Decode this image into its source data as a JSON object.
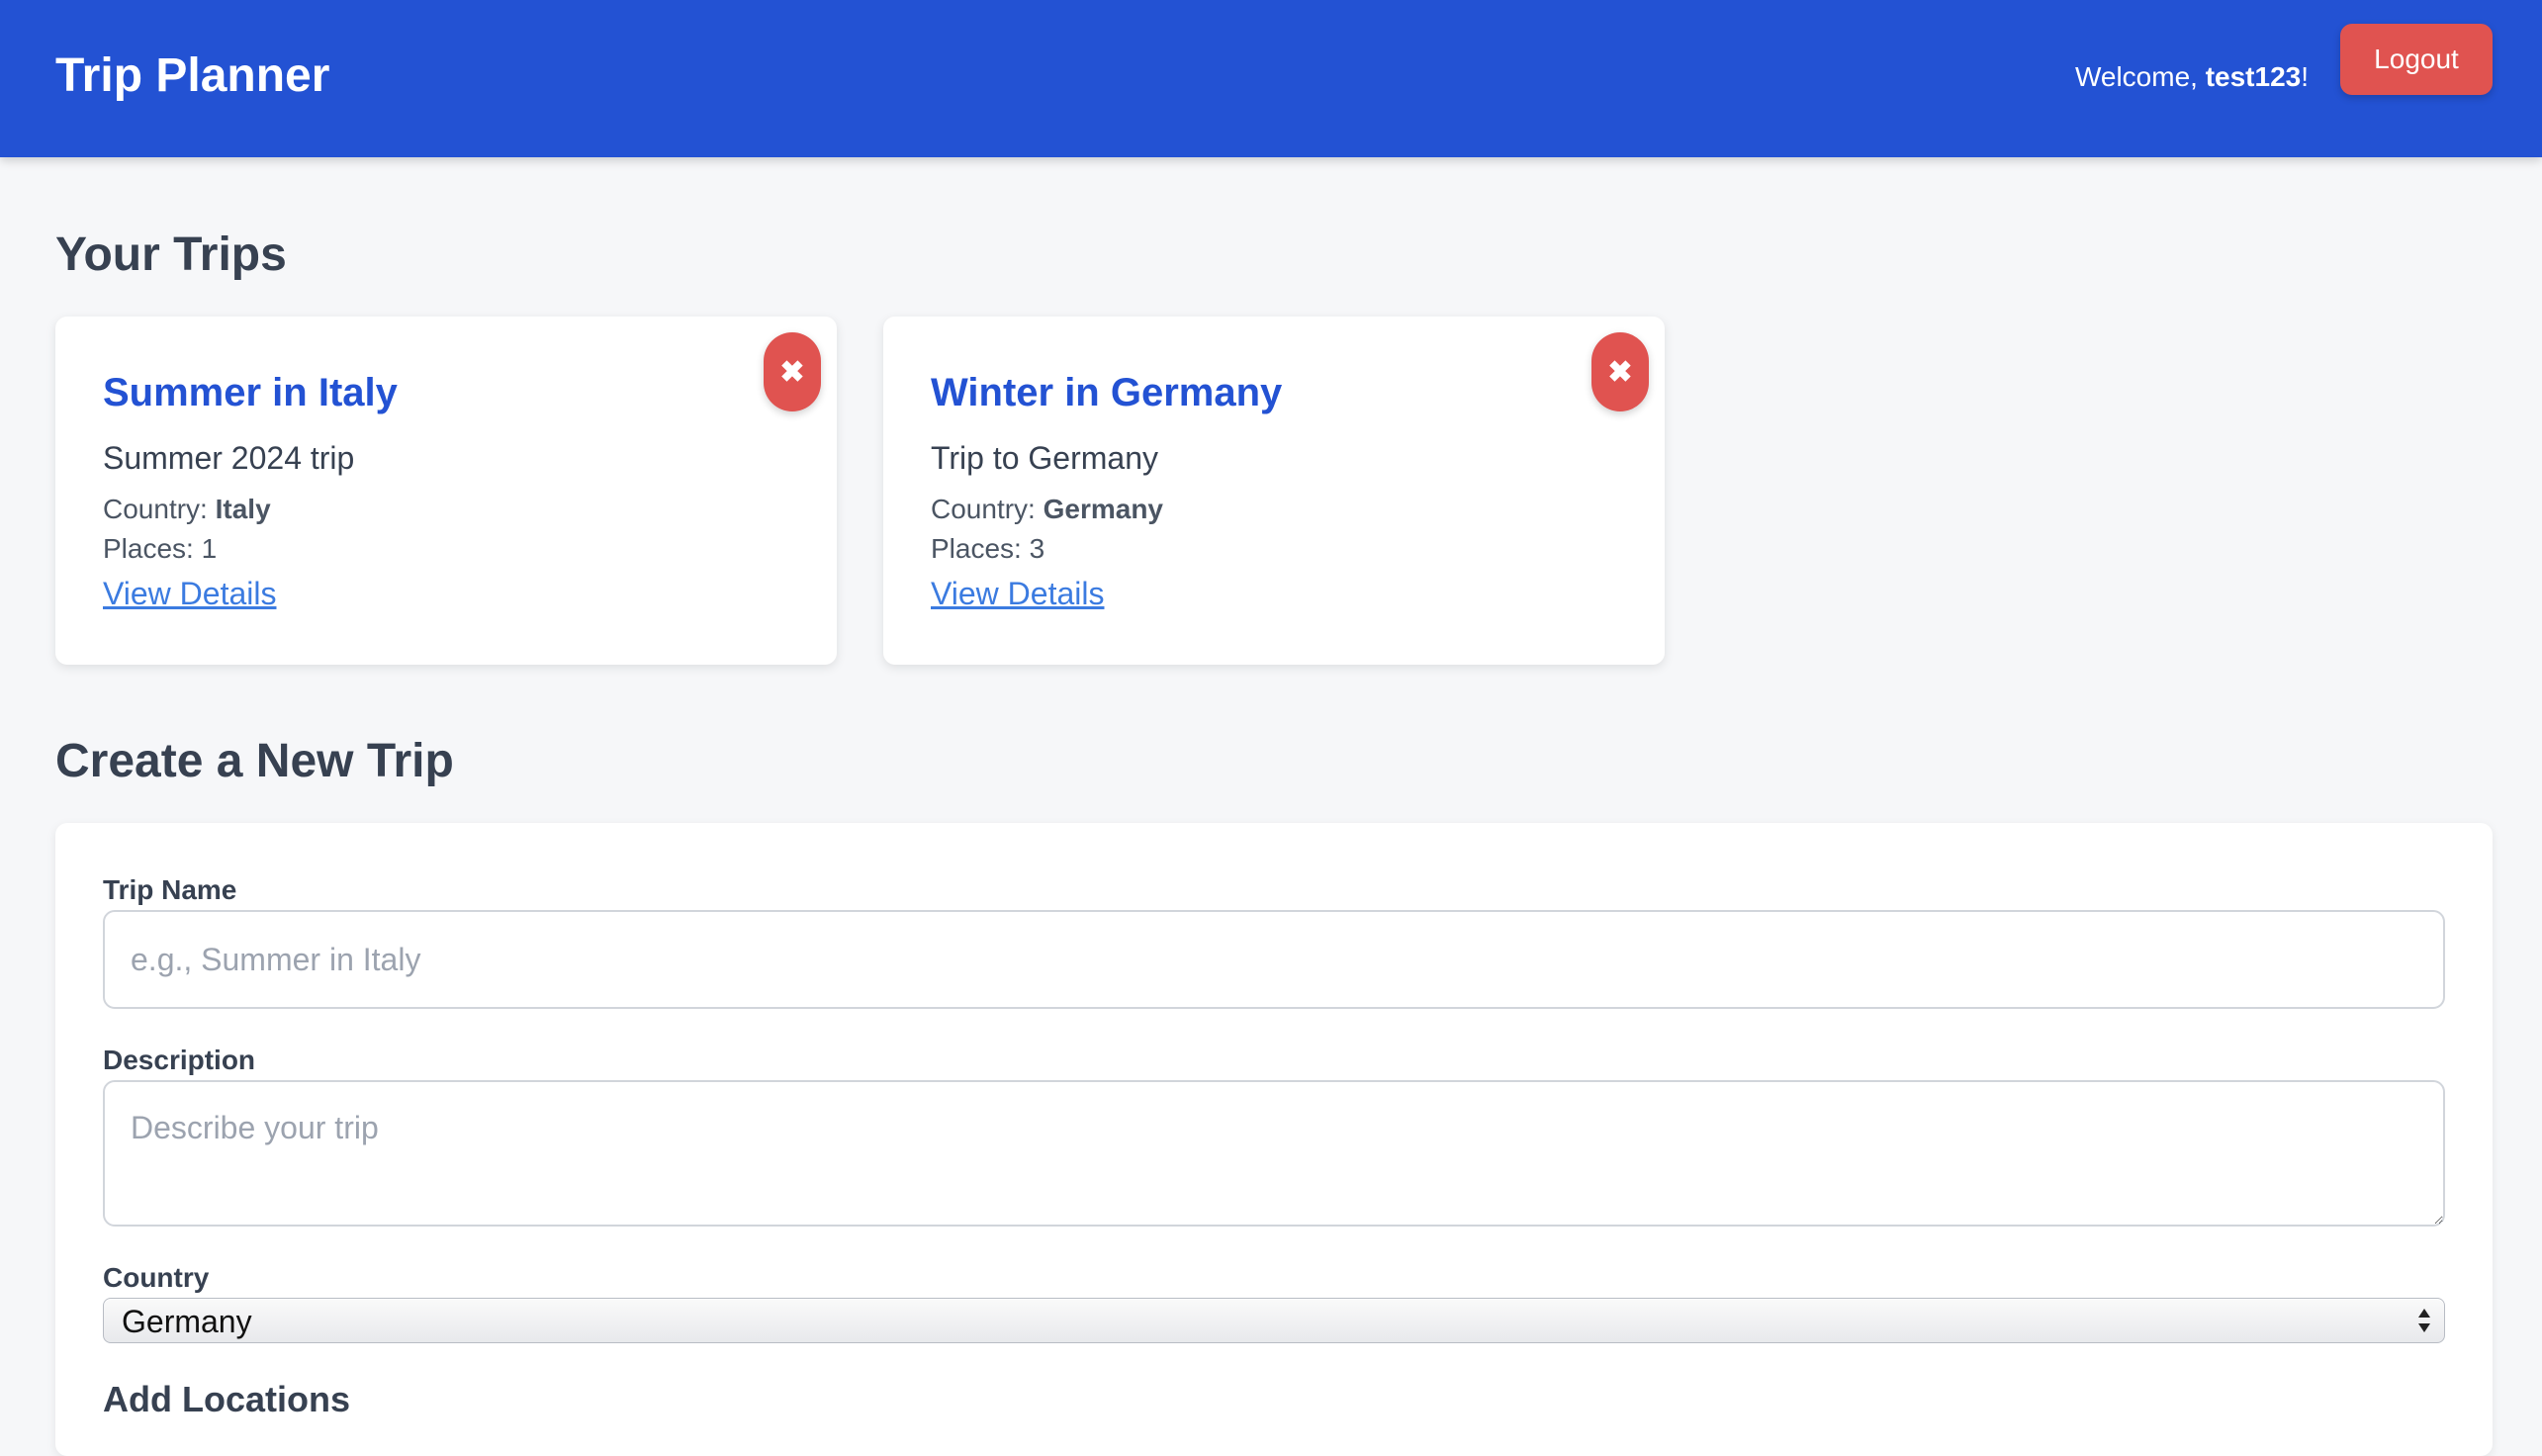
{
  "header": {
    "title": "Trip Planner",
    "welcome_prefix": "Welcome, ",
    "username": "test123",
    "welcome_suffix": "!",
    "logout_label": "Logout"
  },
  "trips_section": {
    "title": "Your Trips",
    "trips": [
      {
        "name": "Summer in Italy",
        "description": "Summer 2024 trip",
        "country_label": "Country: ",
        "country": "Italy",
        "places_label": "Places: ",
        "places": "1",
        "view_label": "View Details",
        "delete_icon": "close-icon"
      },
      {
        "name": "Winter in Germany",
        "description": "Trip to Germany",
        "country_label": "Country: ",
        "country": "Germany",
        "places_label": "Places: ",
        "places": "3",
        "view_label": "View Details",
        "delete_icon": "close-icon"
      }
    ]
  },
  "create_section": {
    "title": "Create a New Trip",
    "trip_name": {
      "label": "Trip Name",
      "placeholder": "e.g., Summer in Italy",
      "value": ""
    },
    "description": {
      "label": "Description",
      "placeholder": "Describe your trip",
      "value": ""
    },
    "country": {
      "label": "Country",
      "selected": "Germany"
    },
    "add_locations_title": "Add Locations"
  },
  "colors": {
    "header_bg": "#2352d3",
    "accent_blue": "#2352d3",
    "link_blue": "#3b7be0",
    "danger_red": "#e05350",
    "page_bg": "#f6f7f9"
  }
}
